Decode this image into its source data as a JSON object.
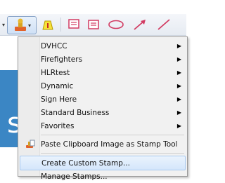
{
  "menu": {
    "items": [
      {
        "label": "DVHCC"
      },
      {
        "label": "Firefighters"
      },
      {
        "label": "HLRtest"
      },
      {
        "label": "Dynamic"
      },
      {
        "label": "Sign Here"
      },
      {
        "label": "Standard Business"
      },
      {
        "label": "Favorites"
      }
    ],
    "paste_clipboard": "Paste Clipboard Image as Stamp Tool",
    "create_custom": "Create Custom Stamp...",
    "manage": "Manage Stamps..."
  },
  "background": {
    "partial_heading": "st"
  },
  "icons": {
    "stamp": "stamp-icon",
    "highlight": "highlighter-icon",
    "note": "comment-icon",
    "text": "text-box-icon",
    "cloud": "cloud-icon",
    "arrow": "arrow-icon",
    "line": "line-icon"
  }
}
